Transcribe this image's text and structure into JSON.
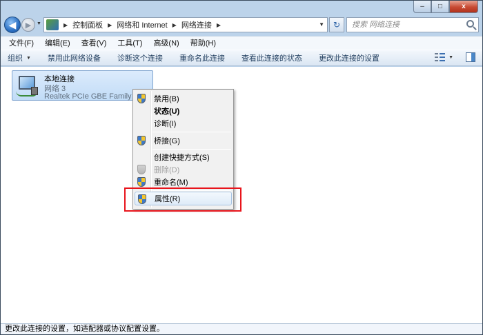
{
  "window": {
    "minimize_label": "–",
    "maximize_label": "□",
    "close_label": "x"
  },
  "address_bar": {
    "breadcrumbs": [
      "控制面板",
      "网络和 Internet",
      "网络连接"
    ],
    "search_placeholder": "搜索 网络连接"
  },
  "menu": {
    "items": [
      "文件(F)",
      "编辑(E)",
      "查看(V)",
      "工具(T)",
      "高级(N)",
      "帮助(H)"
    ]
  },
  "commands": {
    "organize": "组织",
    "items": [
      "禁用此网络设备",
      "诊断这个连接",
      "重命名此连接",
      "查看此连接的状态",
      "更改此连接的设置"
    ]
  },
  "connection": {
    "name": "本地连接",
    "network": "网络  3",
    "adapter": "Realtek PCIe GBE Family Controller"
  },
  "context_menu": {
    "items": [
      {
        "label": "禁用(B)",
        "shield": true,
        "bold": false,
        "disabled": false
      },
      {
        "label": "状态(U)",
        "shield": false,
        "bold": true,
        "disabled": false
      },
      {
        "label": "诊断(I)",
        "shield": false,
        "bold": false,
        "disabled": false
      },
      {
        "label": "桥接(G)",
        "shield": true,
        "bold": false,
        "disabled": false
      },
      {
        "label": "创建快捷方式(S)",
        "shield": false,
        "bold": false,
        "disabled": false
      },
      {
        "label": "删除(D)",
        "shield": true,
        "bold": false,
        "disabled": true
      },
      {
        "label": "重命名(M)",
        "shield": true,
        "bold": false,
        "disabled": false
      },
      {
        "label": "属性(R)",
        "shield": true,
        "bold": false,
        "disabled": false,
        "highlighted": true
      }
    ]
  },
  "status_bar": {
    "text": "更改此连接的设置，如适配器或协议配置设置。"
  },
  "colors": {
    "highlight_border": "#e8141b",
    "selection_fill": "#c1dcf7"
  }
}
